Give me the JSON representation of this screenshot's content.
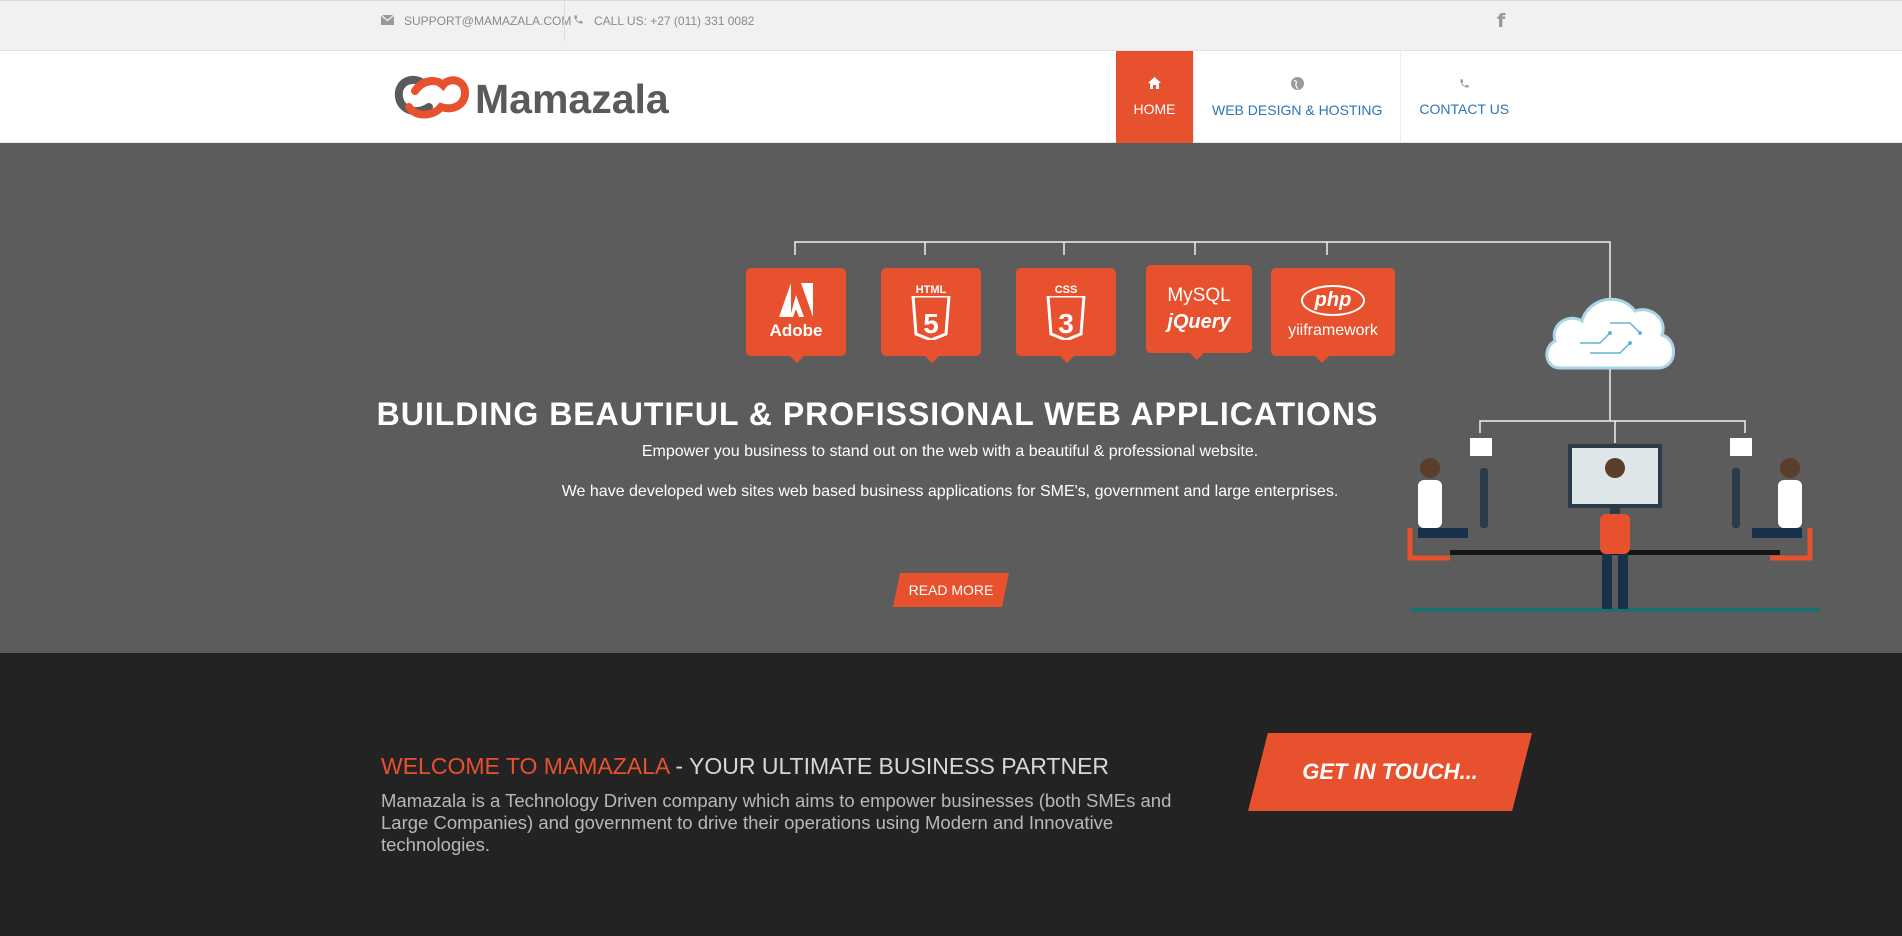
{
  "topbar": {
    "email": "SUPPORT@MAMAZALA.COM",
    "phone": "CALL US: +27 (011) 331 0082",
    "social_icon": "facebook-icon"
  },
  "header": {
    "logo_text": "Mamazala",
    "nav": [
      {
        "label": "HOME",
        "icon": "home-icon",
        "active": true
      },
      {
        "label": "WEB DESIGN & HOSTING",
        "icon": "globe-icon",
        "active": false
      },
      {
        "label": "CONTACT US",
        "icon": "phone-icon",
        "active": false
      }
    ]
  },
  "hero": {
    "title": "BUILDING BEAUTIFUL & PROFISSIONAL WEB APPLICATIONS",
    "line1": "Empower you business to stand out on the web with a beautiful & professional website.",
    "line2": "We have developed web sites web based business applications for SME's, government and large enterprises.",
    "cta": "READ MORE",
    "badges": [
      {
        "top": "Adobe",
        "bottom": ""
      },
      {
        "top": "HTML",
        "bottom": "5"
      },
      {
        "top": "CSS",
        "bottom": "3"
      },
      {
        "top": "MySQL",
        "bottom": "jQuery"
      },
      {
        "top": "php",
        "bottom": "yiiframework"
      }
    ]
  },
  "welcome": {
    "title_accent": "WELCOME TO MAMAZALA",
    "title_rest": " - YOUR ULTIMATE BUSINESS PARTNER",
    "text": "Mamazala is a Technology Driven company which aims to empower businesses (both SMEs and Large Companies) and government to drive their operations using Modern and Innovative technologies.",
    "cta": "GET IN TOUCH..."
  },
  "colors": {
    "accent": "#e8512e",
    "hero_bg": "#5c5c5c",
    "welcome_bg": "#232323",
    "link": "#2d75b5"
  }
}
